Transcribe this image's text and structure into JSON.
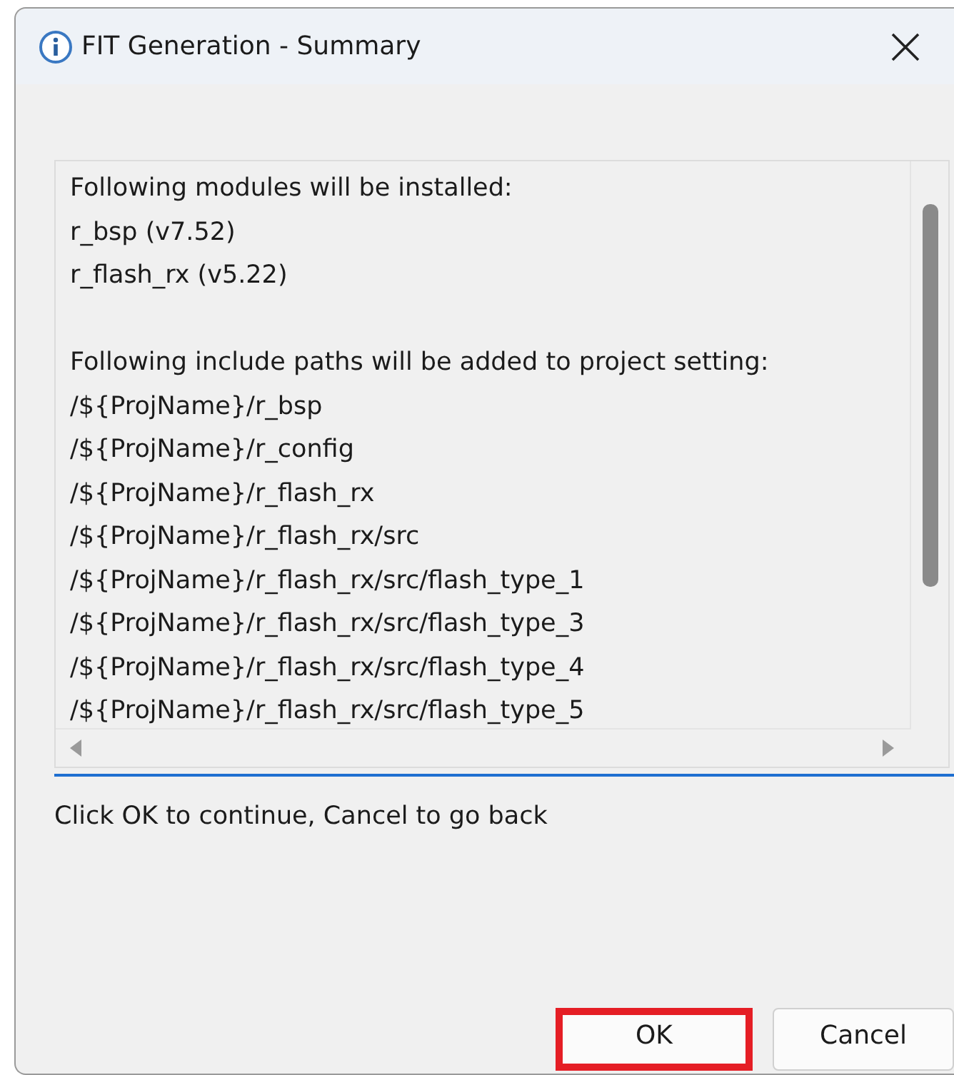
{
  "window": {
    "title": "FIT Generation - Summary"
  },
  "summary_sections": [
    {
      "lines": [
        "Following modules will be installed:",
        "r_bsp (v7.52)",
        "r_flash_rx (v5.22)"
      ]
    },
    {
      "lines": [
        "Following include paths will be added to project setting:",
        "/${ProjName}/r_bsp",
        "/${ProjName}/r_config",
        "/${ProjName}/r_flash_rx",
        "/${ProjName}/r_flash_rx/src",
        "/${ProjName}/r_flash_rx/src/flash_type_1",
        "/${ProjName}/r_flash_rx/src/flash_type_3",
        "/${ProjName}/r_flash_rx/src/flash_type_4",
        "/${ProjName}/r_flash_rx/src/flash_type_5"
      ]
    }
  ],
  "instruction": "Click OK to continue, Cancel to go back",
  "buttons": [
    {
      "label": "OK",
      "highlighted": true
    },
    {
      "label": "Cancel",
      "highlighted": false
    }
  ]
}
